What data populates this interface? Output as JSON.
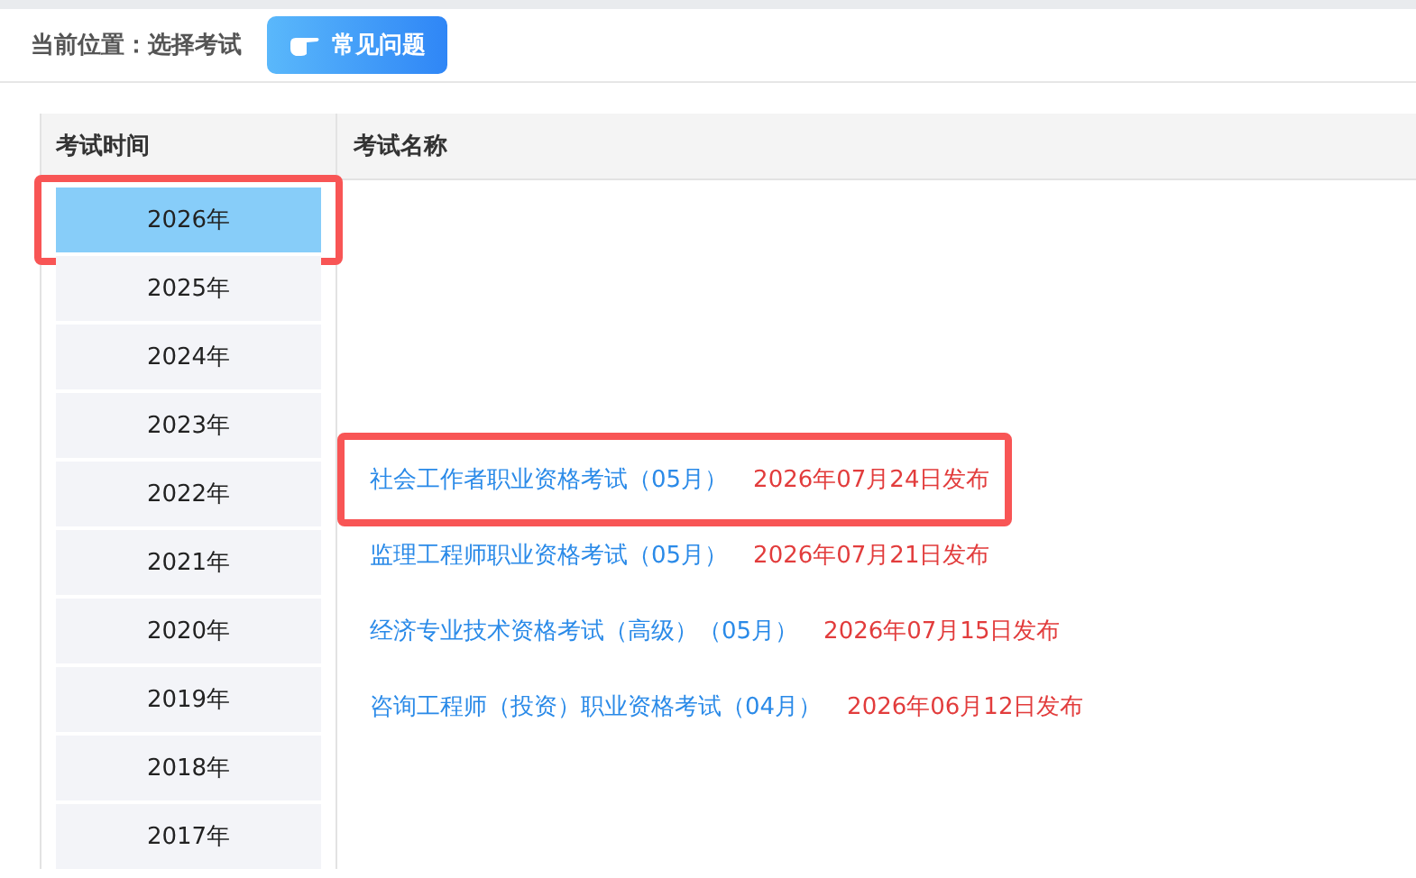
{
  "breadcrumb": "当前位置：选择考试",
  "faq_button": {
    "label": "常见问题"
  },
  "table": {
    "columns": [
      "考试时间",
      "考试名称"
    ],
    "years": [
      {
        "label": "2026年",
        "selected": true,
        "highlighted": true
      },
      {
        "label": "2025年",
        "selected": false,
        "highlighted": false
      },
      {
        "label": "2024年",
        "selected": false,
        "highlighted": false
      },
      {
        "label": "2023年",
        "selected": false,
        "highlighted": false
      },
      {
        "label": "2022年",
        "selected": false,
        "highlighted": false
      },
      {
        "label": "2021年",
        "selected": false,
        "highlighted": false
      },
      {
        "label": "2020年",
        "selected": false,
        "highlighted": false
      },
      {
        "label": "2019年",
        "selected": false,
        "highlighted": false
      },
      {
        "label": "2018年",
        "selected": false,
        "highlighted": false
      },
      {
        "label": "2017年",
        "selected": false,
        "highlighted": false
      }
    ],
    "exams": [
      {
        "name": "社会工作者职业资格考试（05月）",
        "date": "2026年07月24日发布",
        "highlighted": true
      },
      {
        "name": "监理工程师职业资格考试（05月）",
        "date": "2026年07月21日发布",
        "highlighted": false
      },
      {
        "name": "经济专业技术资格考试（高级）（05月）",
        "date": "2026年07月15日发布",
        "highlighted": false
      },
      {
        "name": "咨询工程师（投资）职业资格考试（04月）",
        "date": "2026年06月12日发布",
        "highlighted": false
      }
    ]
  }
}
